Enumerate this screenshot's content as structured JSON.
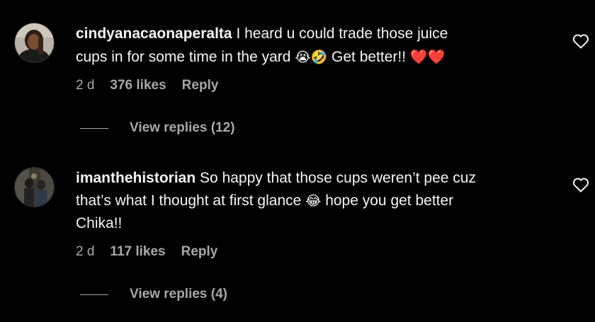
{
  "comments": [
    {
      "username": "cindyanacaonaperalta",
      "text_line1": "I heard u could trade those juice",
      "text_line2": "cups in for some time in the yard",
      "emojis": "😭🤣",
      "text_after": "Get better!!",
      "hearts": "❤️❤️",
      "time": "2 d",
      "likes": "376 likes",
      "reply": "Reply",
      "view_replies": "View replies (12)",
      "like_icon": "heart-outline-icon"
    },
    {
      "username": "imanthehistorian",
      "text_line1": "So happy that those cups weren’t pee cuz",
      "text_line2": "that’s what I thought at first glance",
      "emojis": "😂",
      "text_after": "hope you get better",
      "text_line3": "Chika!!",
      "time": "2 d",
      "likes": "117 likes",
      "reply": "Reply",
      "view_replies": "View replies (4)",
      "like_icon": "heart-outline-icon"
    }
  ],
  "colors": {
    "background": "#000000",
    "primary_text": "#f5f5f5",
    "secondary_text": "#a8a8a8",
    "heart": "#e01b24"
  }
}
